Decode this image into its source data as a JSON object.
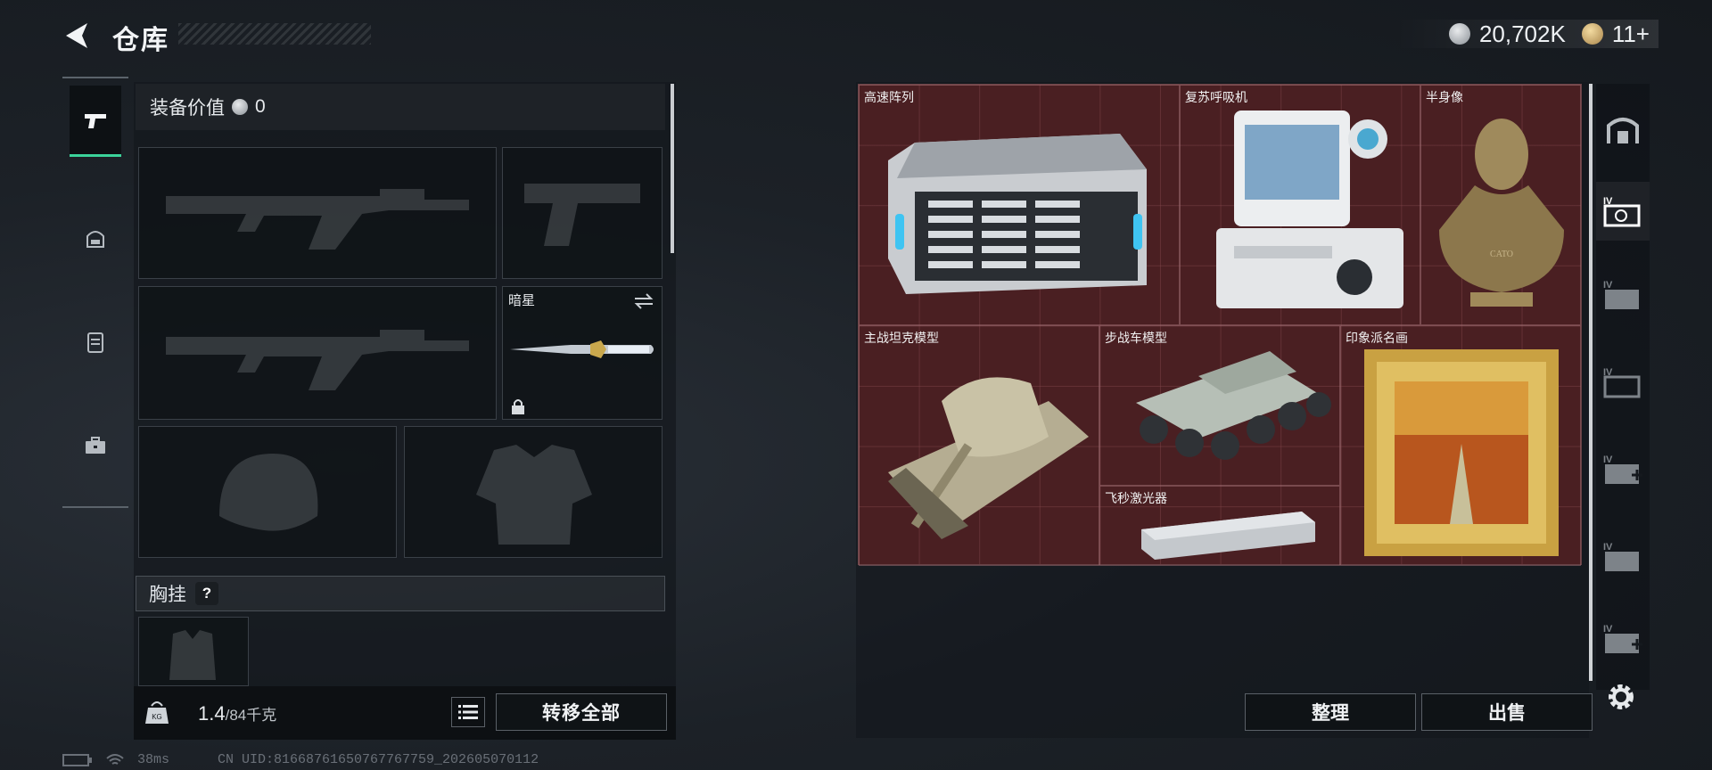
{
  "header": {
    "title": "仓库",
    "back_icon": "back-arrow-icon",
    "currency": [
      {
        "icon": "silver-coin-icon",
        "value": "20,702K"
      },
      {
        "icon": "gold-coin-icon",
        "value": "11+"
      }
    ]
  },
  "left_nav": {
    "items": [
      {
        "name": "weapons",
        "icon": "pistol-icon",
        "active": true
      },
      {
        "name": "helmet",
        "icon": "helmet-icon",
        "active": false
      },
      {
        "name": "armor",
        "icon": "vest-icon",
        "active": false
      },
      {
        "name": "backpack",
        "icon": "briefcase-icon",
        "active": false
      }
    ]
  },
  "equipment": {
    "value_label": "装备价值",
    "value": "0",
    "melee_slot": {
      "name": "暗星",
      "icon": "swap-icon",
      "lock_icon": "lock-icon"
    },
    "chest_rig_label": "胸挂",
    "help": "?",
    "weight_current": "1.4",
    "weight_max": "/84千克",
    "transfer_all": "转移全部"
  },
  "stash": {
    "items": [
      {
        "name": "高速阵列",
        "icon": "server-array-icon"
      },
      {
        "name": "复苏呼吸机",
        "icon": "ventilator-icon"
      },
      {
        "name": "半身像",
        "icon": "bust-statue-icon"
      },
      {
        "name": "主战坦克模型",
        "icon": "tank-model-icon"
      },
      {
        "name": "步战车模型",
        "icon": "ifv-model-icon"
      },
      {
        "name": "印象派名画",
        "icon": "painting-icon"
      },
      {
        "name": "飞秒激光器",
        "icon": "laser-device-icon"
      }
    ],
    "sort": "整理",
    "sell": "出售"
  },
  "right_tabs": [
    {
      "icon": "stash-home-icon",
      "active": false
    },
    {
      "icon": "container-iv-icon",
      "active": true
    },
    {
      "icon": "container-iv-icon",
      "active": false
    },
    {
      "icon": "container-iv-icon",
      "active": false
    },
    {
      "icon": "add-container-iv-icon",
      "active": false
    },
    {
      "icon": "container-iv-icon",
      "active": false
    },
    {
      "icon": "add-container-iv-icon",
      "active": false
    }
  ],
  "status_bar": {
    "ping": "38ms",
    "uid": "CN UID:8166876165076776​7759_202605070112"
  },
  "colors": {
    "accent_green": "#3bd39a",
    "stash_bg": "#4a1f22"
  }
}
